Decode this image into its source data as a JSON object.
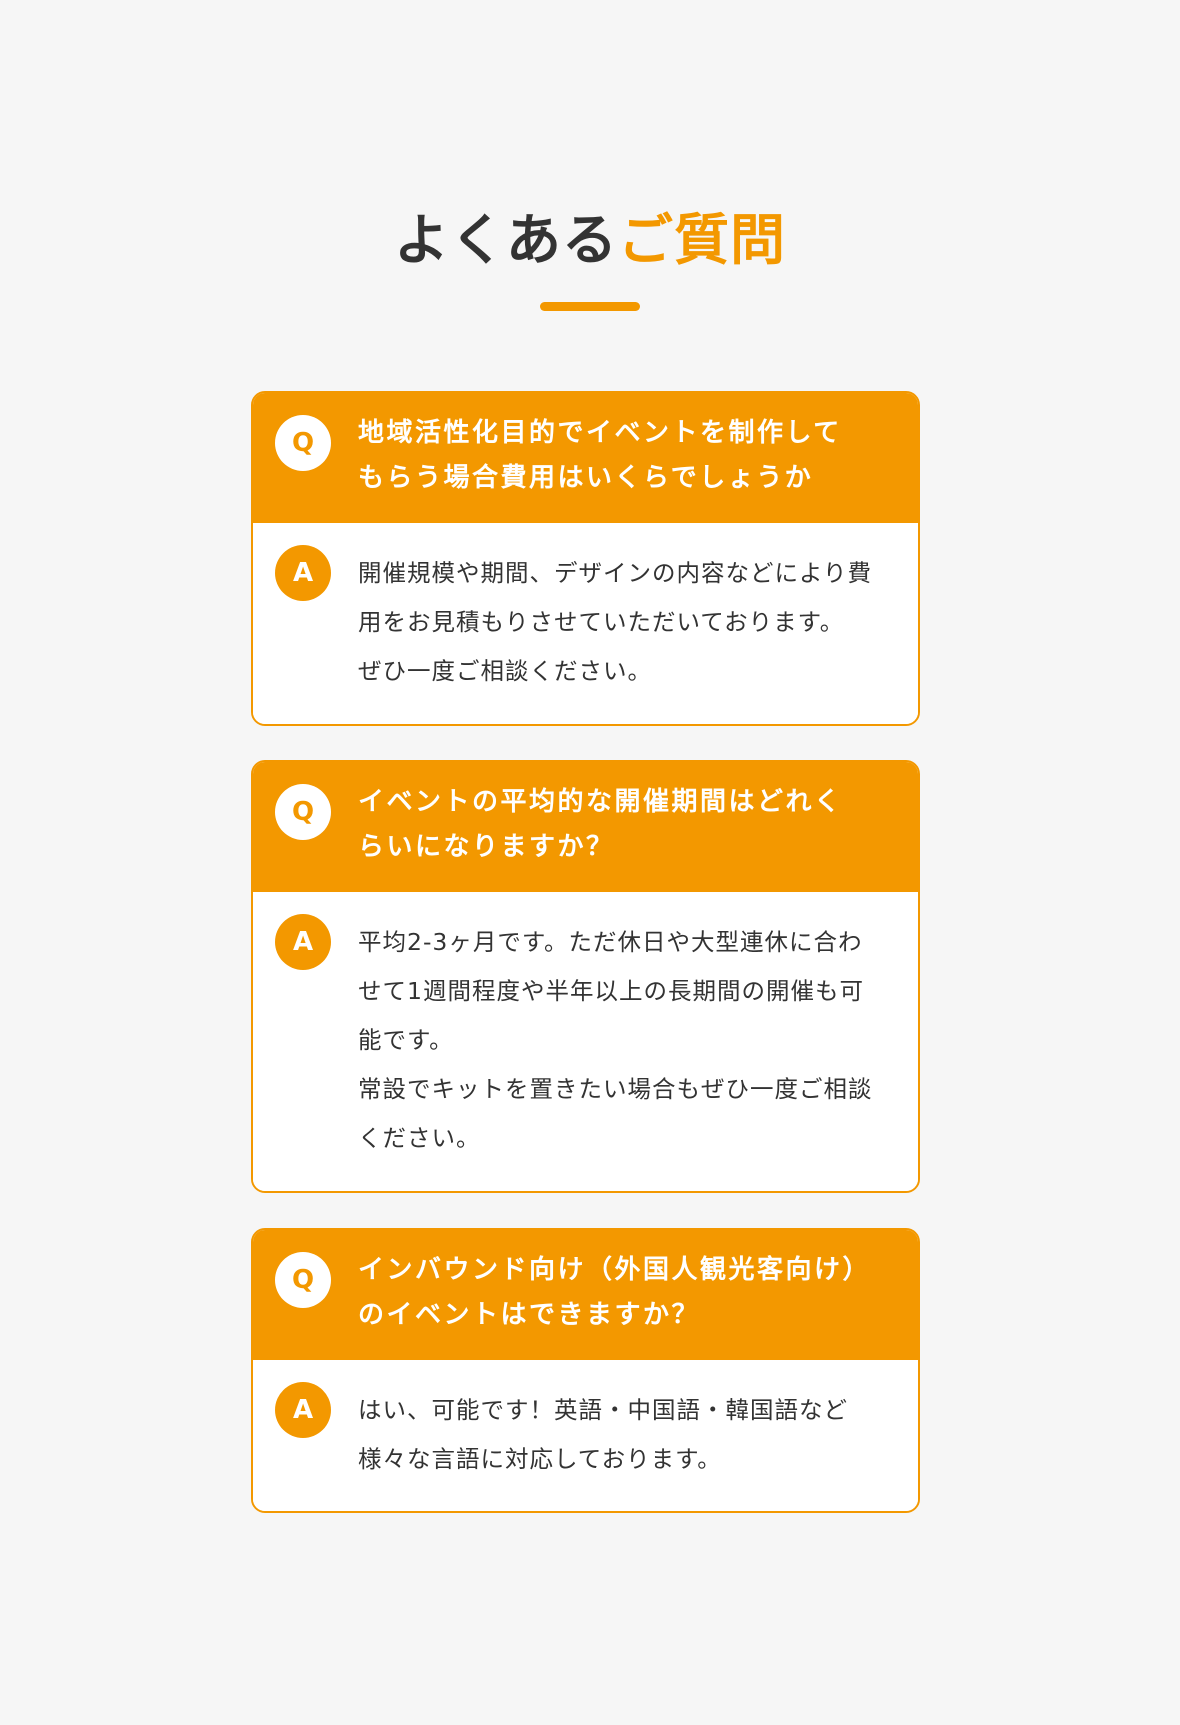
{
  "section": {
    "title_part1": "よくある",
    "title_part2": "ご質問",
    "accent_color": "#f39800",
    "text_color": "#333333",
    "background_color": "#f6f6f6"
  },
  "faq": [
    {
      "q_badge": "Q",
      "question": "地域活性化目的でイベントを制作して\nもらう場合費用はいくらでしょうか",
      "a_badge": "A",
      "answer": "開催規模や期間、デザインの内容などにより費\n用をお見積もりさせていただいております。\nぜひ一度ご相談ください。"
    },
    {
      "q_badge": "Q",
      "question": "イベントの平均的な開催期間はどれく\nらいになりますか？",
      "a_badge": "A",
      "answer": "平均2-3ヶ月です。ただ休日や大型連休に合わ\nせて1週間程度や半年以上の長期間の開催も可\n能です。\n常設でキットを置きたい場合もぜひ一度ご相談\nください。"
    },
    {
      "q_badge": "Q",
      "question": "インバウンド向け（外国人観光客向け）\nのイベントはできますか？",
      "a_badge": "A",
      "answer": "はい、可能です！英語・中国語・韓国語など\n様々な言語に対応しております。"
    }
  ]
}
